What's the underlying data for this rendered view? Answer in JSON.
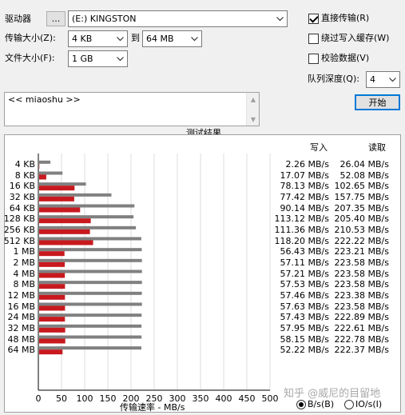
{
  "drive": {
    "label": "驱动器",
    "browse_label": "...",
    "value": "(E:) KINGSTON"
  },
  "transfer_size": {
    "label": "传输大小(Z):",
    "from": "4 KB",
    "to_label": "到",
    "to": "64 MB"
  },
  "file_size": {
    "label": "文件大小(F):",
    "value": "1 GB"
  },
  "options": {
    "direct_io": {
      "label": "直接传输(R)",
      "checked": true
    },
    "bypass_cache": {
      "label": "绕过写入缓存(W)",
      "checked": false
    },
    "verify": {
      "label": "校验数据(V)",
      "checked": false
    },
    "queue_depth": {
      "label": "队列深度(Q):",
      "value": "4"
    }
  },
  "start_button": "开始",
  "description": "<< miaoshu >>",
  "results": {
    "title": "测试结果",
    "legend_write": "写入",
    "legend_read": "读取",
    "col_write": "写入",
    "col_read": "读取",
    "write_values": [
      "2.26 MB/s",
      "17.07 MB/s",
      "78.13 MB/s",
      "77.42 MB/s",
      "90.14 MB/s",
      "113.12 MB/s",
      "111.36 MB/s",
      "118.20 MB/s",
      "56.43 MB/s",
      "57.11 MB/s",
      "57.21 MB/s",
      "57.53 MB/s",
      "57.46 MB/s",
      "57.63 MB/s",
      "57.43 MB/s",
      "57.95 MB/s",
      "58.15 MB/s",
      "52.22 MB/s"
    ],
    "read_values": [
      "26.04 MB/s",
      "52.08 MB/s",
      "102.65 MB/s",
      "157.75 MB/s",
      "207.35 MB/s",
      "205.40 MB/s",
      "210.53 MB/s",
      "222.22 MB/s",
      "223.21 MB/s",
      "223.58 MB/s",
      "223.58 MB/s",
      "223.58 MB/s",
      "223.38 MB/s",
      "223.58 MB/s",
      "222.89 MB/s",
      "222.61 MB/s",
      "222.78 MB/s",
      "222.37 MB/s"
    ]
  },
  "units": {
    "bytes_label": "B/s(B)",
    "io_label": "IO/s(I)",
    "selected": "B/s(B)"
  },
  "watermark": "知乎 @威尼的目留地",
  "colors": {
    "write": "#c8191e",
    "read": "#808080"
  },
  "chart_data": {
    "type": "bar",
    "orientation": "horizontal",
    "categories": [
      "4 KB",
      "8 KB",
      "16 KB",
      "32 KB",
      "64 KB",
      "128 KB",
      "256 KB",
      "512 KB",
      "1 MB",
      "2 MB",
      "4 MB",
      "8 MB",
      "12 MB",
      "16 MB",
      "24 MB",
      "32 MB",
      "48 MB",
      "64 MB"
    ],
    "series": [
      {
        "name": "写入",
        "values": [
          2.26,
          17.07,
          78.13,
          77.42,
          90.14,
          113.12,
          111.36,
          118.2,
          56.43,
          57.11,
          57.21,
          57.53,
          57.46,
          57.63,
          57.43,
          57.95,
          58.15,
          52.22
        ]
      },
      {
        "name": "读取",
        "values": [
          26.04,
          52.08,
          102.65,
          157.75,
          207.35,
          205.4,
          210.53,
          222.22,
          223.21,
          223.58,
          223.58,
          223.58,
          223.38,
          223.58,
          222.89,
          222.61,
          222.78,
          222.37
        ]
      }
    ],
    "xlabel": "传输速率 - MB/s",
    "xlim": [
      0,
      500
    ],
    "xticks": [
      0,
      50,
      100,
      150,
      200,
      250,
      300,
      350,
      400,
      450,
      500
    ],
    "grid": true
  }
}
